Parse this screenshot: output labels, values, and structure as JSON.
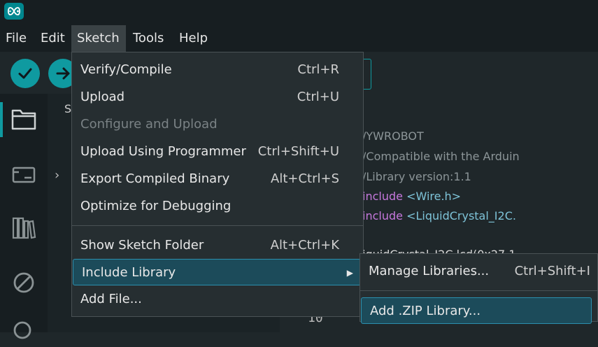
{
  "menubar": {
    "items": [
      {
        "label": "File"
      },
      {
        "label": "Edit"
      },
      {
        "label": "Sketch"
      },
      {
        "label": "Tools"
      },
      {
        "label": "Help"
      }
    ]
  },
  "toolbar": {
    "verify_icon": "checkmark-icon",
    "upload_icon": "arrow-right-icon"
  },
  "activity_bar": {
    "icons": [
      "folder-icon",
      "board-icon",
      "library-icon",
      "debug-icon",
      "search-icon"
    ]
  },
  "sidebar": {
    "header": "S"
  },
  "sketch_menu": {
    "items": [
      {
        "label": "Verify/Compile",
        "shortcut": "Ctrl+R"
      },
      {
        "label": "Upload",
        "shortcut": "Ctrl+U"
      },
      {
        "label": "Configure and Upload",
        "shortcut": ""
      },
      {
        "label": "Upload Using Programmer",
        "shortcut": "Ctrl+Shift+U"
      },
      {
        "label": "Export Compiled Binary",
        "shortcut": "Alt+Ctrl+S"
      },
      {
        "label": "Optimize for Debugging",
        "shortcut": ""
      },
      {
        "label": "Show Sketch Folder",
        "shortcut": "Alt+Ctrl+K"
      },
      {
        "label": "Include Library",
        "shortcut": ""
      },
      {
        "label": "Add File...",
        "shortcut": ""
      }
    ]
  },
  "include_library_submenu": {
    "items": [
      {
        "label": "Manage Libraries...",
        "shortcut": "Ctrl+Shift+I"
      },
      {
        "label": "Add .ZIP Library...",
        "shortcut": ""
      }
    ]
  },
  "editor": {
    "lines": [
      "/YWROBOT",
      "/Compatible with the Arduin",
      "/Library version:1.1",
      "include",
      "<Wire.h>",
      "include",
      "<LiquidCrystal_I2C.",
      "iquidCrystal_I2C lcd(0x27,1"
    ],
    "line_number": "10"
  },
  "colors": {
    "accent": "#0f9aa0",
    "highlight": "#1c4b5a",
    "background": "#1f272a"
  }
}
